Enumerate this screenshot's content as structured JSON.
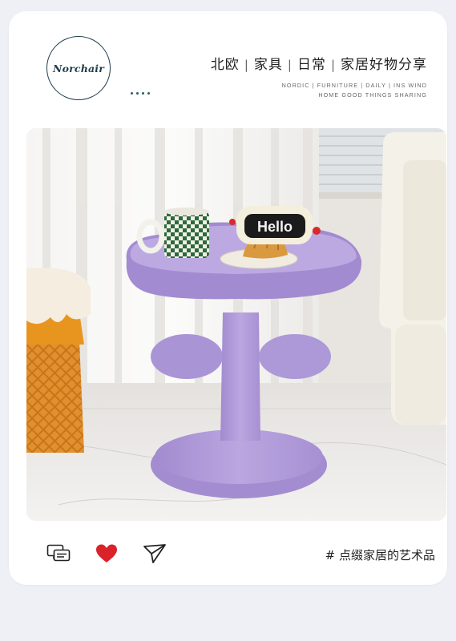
{
  "header": {
    "logo_text": "Norchair",
    "title_parts": [
      "北欧",
      "家具",
      "日常",
      "家居好物分享"
    ],
    "title_separator": "|",
    "subtitle_line1": "NORDIC | FURNITURE | DAILY | INS WIND",
    "subtitle_line2": "HOME GOOD THINGS SHARING"
  },
  "photo": {
    "sign_text": "Hello"
  },
  "actions": {
    "icons": [
      "comment-icon",
      "heart-icon",
      "share-icon"
    ],
    "heart_color": "#d9222a"
  },
  "caption": "# 点缀家居的艺术品",
  "colors": {
    "accent": "#1f3d4a",
    "table_purple": "#b7a2dd",
    "background": "#eef0f6"
  }
}
